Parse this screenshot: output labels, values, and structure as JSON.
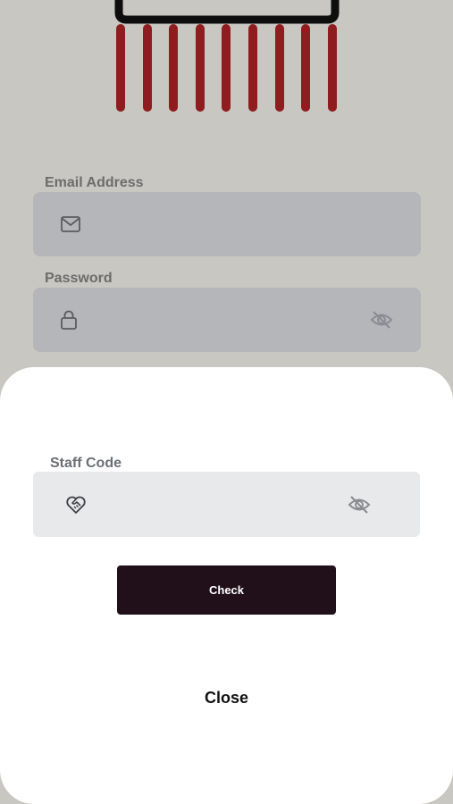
{
  "login": {
    "email": {
      "label": "Email Address",
      "icon": "mail-icon"
    },
    "password": {
      "label": "Password",
      "icon": "lock-icon",
      "toggle_icon": "eye-off-icon"
    }
  },
  "modal": {
    "staff_code": {
      "label": "Staff Code",
      "icon": "heart-handshake-icon",
      "toggle_icon": "eye-off-icon"
    },
    "check_label": "Check",
    "close_label": "Close"
  },
  "colors": {
    "logo_bristle": "#8f1d1f",
    "button": "#211019",
    "overlay_bg": "#c8c7c2",
    "field_dim": "#b5b6b9",
    "field": "#e8e9eb"
  }
}
